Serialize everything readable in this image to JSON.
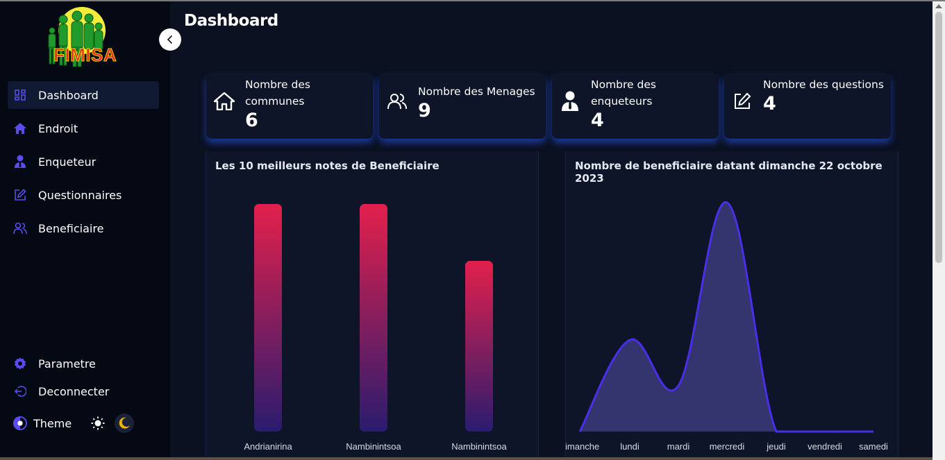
{
  "brand": {
    "logo_text": "FIMISA"
  },
  "sidebar": {
    "items": [
      {
        "label": "Dashboard",
        "icon": "grid-icon"
      },
      {
        "label": "Endroit",
        "icon": "home-icon"
      },
      {
        "label": "Enqueteur",
        "icon": "user-tie-icon"
      },
      {
        "label": "Questionnaires",
        "icon": "edit-icon"
      },
      {
        "label": "Beneficiaire",
        "icon": "users-icon"
      }
    ],
    "bottom": [
      {
        "label": "Parametre",
        "icon": "gear-icon"
      },
      {
        "label": "Deconnecter",
        "icon": "logout-icon"
      }
    ],
    "theme_label": "Theme"
  },
  "header": {
    "title": "Dashboard"
  },
  "cards": [
    {
      "label": "Nombre des communes",
      "value": "6",
      "icon": "home-icon"
    },
    {
      "label": "Nombre des Menages",
      "value": "9",
      "icon": "users-icon"
    },
    {
      "label": "Nombre des enqueteurs",
      "value": "4",
      "icon": "user-tie-icon"
    },
    {
      "label": "Nombre des questions",
      "value": "4",
      "icon": "edit-icon"
    }
  ],
  "colors": {
    "accent": "#3d5afe",
    "bar_top": "#e3204c",
    "bar_bottom": "#2a1c6e",
    "area_stroke": "#4b2ee8",
    "area_fill": "#3b3a7a"
  },
  "chart_data": [
    {
      "type": "bar",
      "title": "Les 10 meilleurs notes de Beneficiaire",
      "categories": [
        "Andrianirina",
        "Nambinintsoa",
        "Nambinintsoa"
      ],
      "values": [
        100,
        100,
        75
      ],
      "ylim": [
        0,
        100
      ],
      "grid": false,
      "legend": "none"
    },
    {
      "type": "area",
      "title": "Nombre de beneficiaire datant dimanche 22 octobre 2023",
      "categories": [
        "dimanche",
        "lundi",
        "mardi",
        "mercredi",
        "jeudi",
        "vendredi",
        "samedi"
      ],
      "values": [
        0,
        4,
        2,
        10,
        0,
        0,
        0
      ],
      "ylim": [
        0,
        10
      ],
      "grid": false,
      "legend": "none"
    }
  ]
}
